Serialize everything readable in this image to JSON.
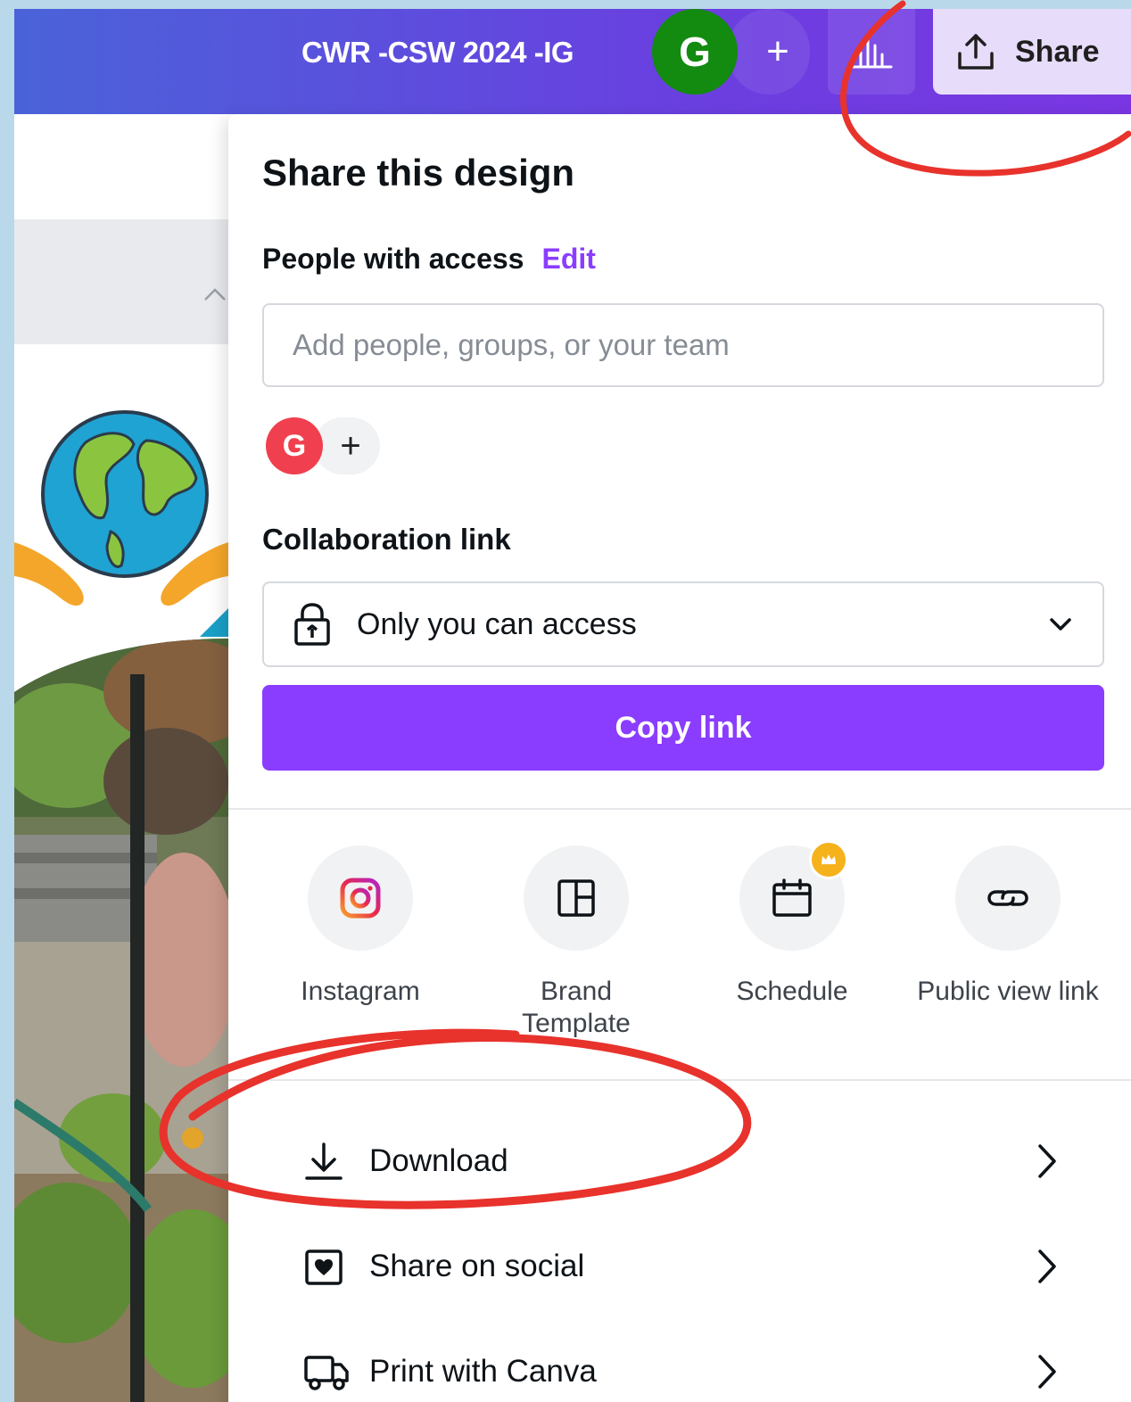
{
  "topbar": {
    "doc_title": "CWR -CSW 2024 -IG",
    "avatar_initial": "G",
    "add_collaborator": "+",
    "share_label": "Share"
  },
  "panel": {
    "title": "Share this design",
    "people_access_label": "People with access",
    "edit_label": "Edit",
    "add_people_placeholder": "Add people, groups, or your team",
    "member_initial": "G",
    "add_member": "+",
    "collab_link_label": "Collaboration link",
    "access_value": "Only you can access",
    "copy_link_label": "Copy link",
    "share_options": [
      {
        "label": "Instagram",
        "icon": "instagram-icon"
      },
      {
        "label": "Brand Template",
        "icon": "brand-template-icon"
      },
      {
        "label": "Schedule",
        "icon": "calendar-icon"
      },
      {
        "label": "Public view link",
        "icon": "link-icon"
      }
    ],
    "menu": [
      {
        "label": "Download",
        "icon": "download-icon"
      },
      {
        "label": "Share on social",
        "icon": "heart-icon"
      },
      {
        "label": "Print with Canva",
        "icon": "truck-icon"
      }
    ]
  },
  "colors": {
    "accent": "#8b3dff",
    "topbar_start": "#4a63d9",
    "topbar_end": "#7a36e2",
    "annotation": "#e8322c"
  }
}
